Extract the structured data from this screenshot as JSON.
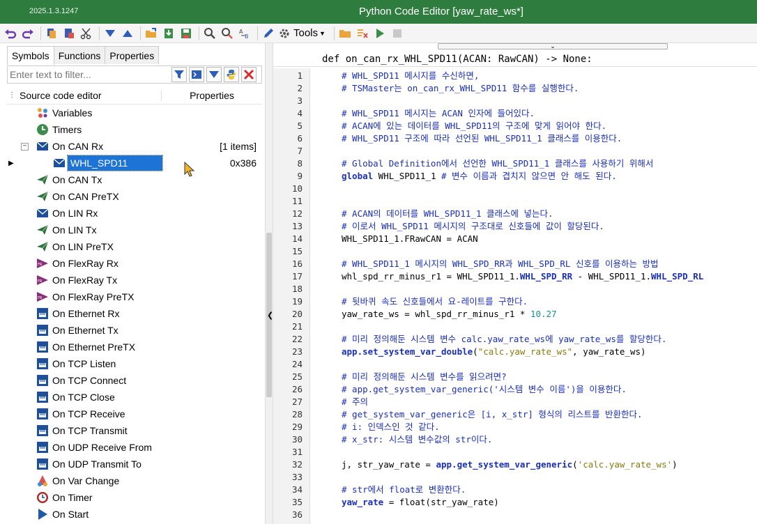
{
  "window": {
    "version": "2025.1.3.1247",
    "title": "Python Code Editor [yaw_rate_ws*]"
  },
  "toolbar": {
    "tools_label": "Tools"
  },
  "left_panel": {
    "tabs": [
      "Symbols",
      "Functions",
      "Properties"
    ],
    "filter_placeholder": "Enter text to filter...",
    "header": {
      "col1": "Source code editor",
      "col2": "Properties"
    },
    "tree": [
      {
        "label": "Variables",
        "value": "",
        "icon": "variables-icon"
      },
      {
        "label": "Timers",
        "value": "",
        "icon": "clock-icon"
      },
      {
        "label": "On CAN Rx",
        "value": "[1 items]",
        "icon": "envelope-icon"
      },
      {
        "label": "WHL_SPD11",
        "value": "0x386",
        "icon": "envelope-icon"
      },
      {
        "label": "On CAN Tx",
        "value": "",
        "icon": "send-icon"
      },
      {
        "label": "On CAN PreTX",
        "value": "",
        "icon": "send-icon"
      },
      {
        "label": "On LIN Rx",
        "value": "",
        "icon": "envelope-icon"
      },
      {
        "label": "On LIN Tx",
        "value": "",
        "icon": "send-icon"
      },
      {
        "label": "On LIN PreTX",
        "value": "",
        "icon": "send-icon"
      },
      {
        "label": "On FlexRay Rx",
        "value": "",
        "icon": "flexray-icon"
      },
      {
        "label": "On FlexRay Tx",
        "value": "",
        "icon": "flexray-icon"
      },
      {
        "label": "On FlexRay PreTX",
        "value": "",
        "icon": "flexray-icon"
      },
      {
        "label": "On Ethernet Rx",
        "value": "",
        "icon": "ethernet-icon"
      },
      {
        "label": "On Ethernet Tx",
        "value": "",
        "icon": "ethernet-icon"
      },
      {
        "label": "On Ethernet PreTX",
        "value": "",
        "icon": "ethernet-icon"
      },
      {
        "label": "On TCP Listen",
        "value": "",
        "icon": "ethernet-icon"
      },
      {
        "label": "On TCP Connect",
        "value": "",
        "icon": "ethernet-icon"
      },
      {
        "label": "On TCP Close",
        "value": "",
        "icon": "ethernet-icon"
      },
      {
        "label": "On TCP Receive",
        "value": "",
        "icon": "ethernet-icon"
      },
      {
        "label": "On TCP Transmit",
        "value": "",
        "icon": "ethernet-icon"
      },
      {
        "label": "On UDP Receive From",
        "value": "",
        "icon": "ethernet-icon"
      },
      {
        "label": "On UDP Transmit To",
        "value": "",
        "icon": "ethernet-icon"
      },
      {
        "label": "On Var Change",
        "value": "",
        "icon": "var-change-icon"
      },
      {
        "label": "On Timer",
        "value": "",
        "icon": "timer-icon"
      },
      {
        "label": "On Start",
        "value": "",
        "icon": "play-icon"
      }
    ]
  },
  "editor": {
    "function_header": "def on_can_rx_WHL_SPD11(ACAN: RawCAN) -> None:",
    "lines": [
      {
        "n": "1",
        "parts": [
          {
            "c": "cm",
            "t": "# WHL_SPD11 메시지를 수신하면,"
          }
        ]
      },
      {
        "n": "2",
        "parts": [
          {
            "c": "cm",
            "t": "# TSMaster는 on_can_rx_WHL_SPD11 함수를 실행한다."
          }
        ]
      },
      {
        "n": "3",
        "parts": []
      },
      {
        "n": "4",
        "parts": [
          {
            "c": "cm",
            "t": "# WHL_SPD11 메시지는 ACAN 인자에 들어있다."
          }
        ]
      },
      {
        "n": "5",
        "parts": [
          {
            "c": "cm",
            "t": "# ACAN에 있는 데이터를 WHL_SPD11의 구조에 맞게 읽어야 한다."
          }
        ]
      },
      {
        "n": "6",
        "parts": [
          {
            "c": "cm",
            "t": "# WHL_SPD11 구조에 따라 선언된 WHL_SPD11_1 클래스를 이용한다."
          }
        ]
      },
      {
        "n": "7",
        "parts": []
      },
      {
        "n": "8",
        "parts": [
          {
            "c": "cm",
            "t": "# Global Definition에서 선언한 WHL_SPD11_1 클래스를 사용하기 위해서"
          }
        ]
      },
      {
        "n": "9",
        "parts": [
          {
            "c": "kw",
            "t": "global"
          },
          {
            "c": "",
            "t": " WHL_SPD11_1 "
          },
          {
            "c": "cm",
            "t": "# 변수 이름과 겹치지 않으면 안 해도 된다."
          }
        ]
      },
      {
        "n": "10",
        "parts": []
      },
      {
        "n": "11",
        "parts": []
      },
      {
        "n": "12",
        "parts": [
          {
            "c": "cm",
            "t": "# ACAN의 데이터를 WHL_SPD11_1 클래스에 넣는다."
          }
        ]
      },
      {
        "n": "13",
        "parts": [
          {
            "c": "cm",
            "t": "# 이로서 WHL_SPD11 메시지의 구조대로 신호들에 값이 할당된다."
          }
        ]
      },
      {
        "n": "14",
        "parts": [
          {
            "c": "",
            "t": "WHL_SPD11_1.FRawCAN = ACAN"
          }
        ]
      },
      {
        "n": "15",
        "parts": []
      },
      {
        "n": "16",
        "parts": [
          {
            "c": "cm",
            "t": "# WHL_SPD11_1 메시지의 WHL_SPD_RR과 WHL_SPD_RL 신호를 이용하는 방법"
          }
        ]
      },
      {
        "n": "17",
        "parts": [
          {
            "c": "",
            "t": "whl_spd_rr_minus_r1 = WHL_SPD11_1."
          },
          {
            "c": "kw",
            "t": "WHL_SPD_RR"
          },
          {
            "c": "",
            "t": " - WHL_SPD11_1."
          },
          {
            "c": "kw",
            "t": "WHL_SPD_RL"
          }
        ]
      },
      {
        "n": "18",
        "parts": []
      },
      {
        "n": "19",
        "parts": [
          {
            "c": "cm",
            "t": "# 뒷바퀴 속도 신호들에서 요-레이트를 구한다."
          }
        ]
      },
      {
        "n": "20",
        "parts": [
          {
            "c": "",
            "t": "yaw_rate_ws = whl_spd_rr_minus_r1 * "
          },
          {
            "c": "num",
            "t": "10.27"
          }
        ]
      },
      {
        "n": "21",
        "parts": []
      },
      {
        "n": "22",
        "parts": [
          {
            "c": "cm",
            "t": "# 미리 정의해둔 시스템 변수 calc.yaw_rate_ws에 yaw_rate_ws를 할당한다."
          }
        ]
      },
      {
        "n": "23",
        "parts": [
          {
            "c": "kw",
            "t": "app.set_system_var_double"
          },
          {
            "c": "",
            "t": "("
          },
          {
            "c": "str",
            "t": "\"calc.yaw_rate_ws\""
          },
          {
            "c": "",
            "t": ", yaw_rate_ws)"
          }
        ]
      },
      {
        "n": "24",
        "parts": []
      },
      {
        "n": "25",
        "parts": [
          {
            "c": "cm",
            "t": "# 미리 정의해둔 시스템 변수를 읽으려면?"
          }
        ]
      },
      {
        "n": "26",
        "parts": [
          {
            "c": "cm",
            "t": "# app.get_system_var_generic('시스템 변수 이름')을 이용한다."
          }
        ]
      },
      {
        "n": "27",
        "parts": [
          {
            "c": "cm",
            "t": "# 주의"
          }
        ]
      },
      {
        "n": "28",
        "parts": [
          {
            "c": "cm",
            "t": "# get_system_var_generic은 [i, x_str] 형식의 리스트를 반환한다."
          }
        ]
      },
      {
        "n": "29",
        "parts": [
          {
            "c": "cm",
            "t": "# i: 인덱스인 것 같다."
          }
        ]
      },
      {
        "n": "30",
        "parts": [
          {
            "c": "cm",
            "t": "# x_str: 시스템 변수값의 str이다."
          }
        ]
      },
      {
        "n": "31",
        "parts": []
      },
      {
        "n": "32",
        "parts": [
          {
            "c": "",
            "t": "j, str_yaw_rate = "
          },
          {
            "c": "kw",
            "t": "app.get_system_var_generic"
          },
          {
            "c": "",
            "t": "("
          },
          {
            "c": "str",
            "t": "'calc.yaw_rate_ws'"
          },
          {
            "c": "",
            "t": ")"
          }
        ]
      },
      {
        "n": "33",
        "parts": []
      },
      {
        "n": "34",
        "parts": [
          {
            "c": "cm",
            "t": "# str에서 float로 변환한다."
          }
        ]
      },
      {
        "n": "35",
        "parts": [
          {
            "c": "kw",
            "t": "yaw_rate"
          },
          {
            "c": "",
            "t": " = float(str_yaw_rate)"
          }
        ]
      },
      {
        "n": "36",
        "parts": []
      }
    ]
  }
}
